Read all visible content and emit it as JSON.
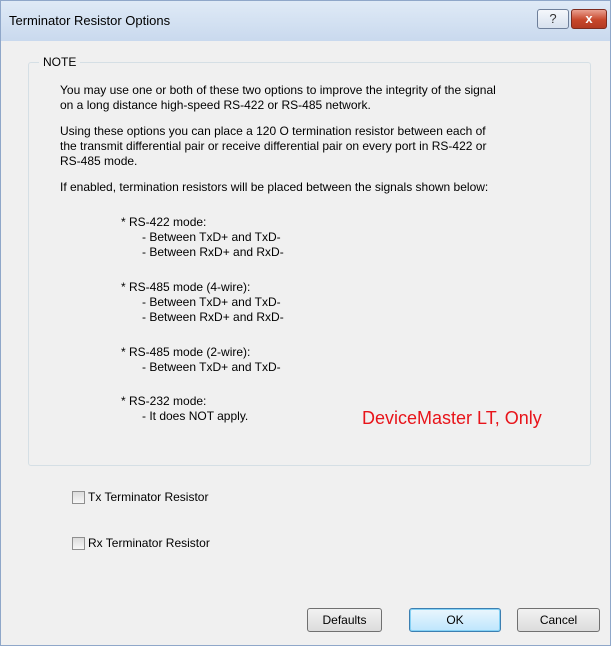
{
  "window": {
    "title": "Terminator Resistor Options"
  },
  "titlebar_buttons": {
    "help": "?",
    "close": "x"
  },
  "note": {
    "legend": "NOTE",
    "para1_line1": "You may use one or both of these two options to improve the integrity of the signal",
    "para1_line2": "on a long distance high-speed RS-422 or RS-485 network.",
    "para2_line1": "Using these options you can place  a 120 O termination resistor between each of",
    "para2_line2": "the transmit differential pair or receive differential pair on every port in RS-422 or",
    "para2_line3": "RS-485 mode.",
    "para3": "If enabled, termination resistors will be placed between the signals shown below:",
    "modes": [
      {
        "heading": "* RS-422 mode:",
        "lines": [
          "- Between TxD+ and TxD-",
          "- Between RxD+ and RxD-"
        ]
      },
      {
        "heading": "* RS-485 mode (4-wire):",
        "lines": [
          "- Between TxD+ and TxD-",
          "- Between RxD+ and RxD-"
        ]
      },
      {
        "heading": "* RS-485 mode (2-wire):",
        "lines": [
          "- Between TxD+ and TxD-"
        ]
      },
      {
        "heading": "* RS-232 mode:",
        "lines": [
          "- It does NOT apply."
        ]
      }
    ],
    "red_note": "DeviceMaster LT, Only"
  },
  "options": {
    "tx_label": "Tx Terminator Resistor",
    "tx_checked": false,
    "rx_label": "Rx Terminator Resistor",
    "rx_checked": false
  },
  "buttons": {
    "defaults": "Defaults",
    "ok": "OK",
    "cancel": "Cancel"
  },
  "colors": {
    "note_accent": "#e8141a",
    "titlebar": "#c9d9ee",
    "close_button": "#c7472b"
  }
}
